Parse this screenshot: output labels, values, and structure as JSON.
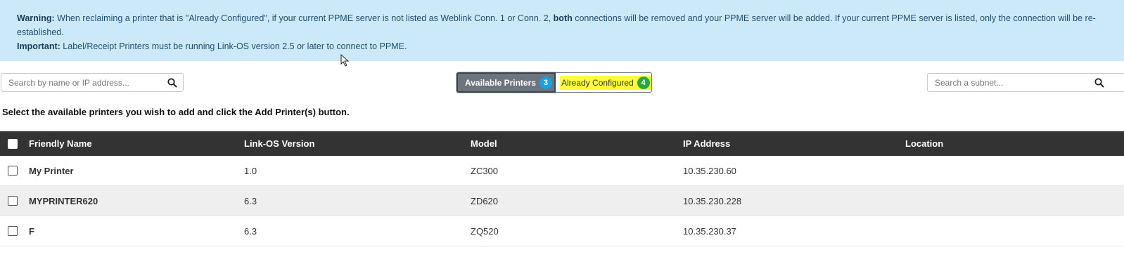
{
  "alert": {
    "warning_label": "Warning:",
    "warning_text_1": " When reclaiming a printer that is \"Already Configured\", if your current PPME server is not listed as Weblink Conn. 1 or Conn. 2, ",
    "warning_bold": "both",
    "warning_text_2": " connections will be removed and your PPME server will be added. If your current PPME server is listed, only the connection will be re-established.",
    "important_label": "Important:",
    "important_text": " Label/Receipt Printers must be running Link-OS version 2.5 or later to connect to PPME."
  },
  "search": {
    "name_placeholder": "Search by name or IP address...",
    "subnet_placeholder": "Search a subnet..."
  },
  "toggle": {
    "available_label": "Available Printers",
    "available_count": "3",
    "configured_label": "Already Configured",
    "configured_count": "4"
  },
  "instruction": "Select the available printers you wish to add and click the Add Printer(s) button.",
  "table": {
    "headers": {
      "name": "Friendly Name",
      "os": "Link-OS Version",
      "model": "Model",
      "ip": "IP Address",
      "location": "Location"
    },
    "rows": [
      {
        "name": "My Printer",
        "os": "1.0",
        "model": "ZC300",
        "ip": "10.35.230.60",
        "location": ""
      },
      {
        "name": "MYPRINTER620",
        "os": "6.3",
        "model": "ZD620",
        "ip": "10.35.230.228",
        "location": ""
      },
      {
        "name": "F",
        "os": "6.3",
        "model": "ZQ520",
        "ip": "10.35.230.37",
        "location": ""
      }
    ]
  },
  "colors": {
    "alert_bg": "#cce9fa",
    "header_bg": "#333333",
    "available_btn": "#6c757d",
    "badge_blue": "#17a2e8",
    "badge_green": "#28a745",
    "highlight": "#ffff3a"
  },
  "icons": [
    "search-icon",
    "mouse-cursor-icon"
  ]
}
